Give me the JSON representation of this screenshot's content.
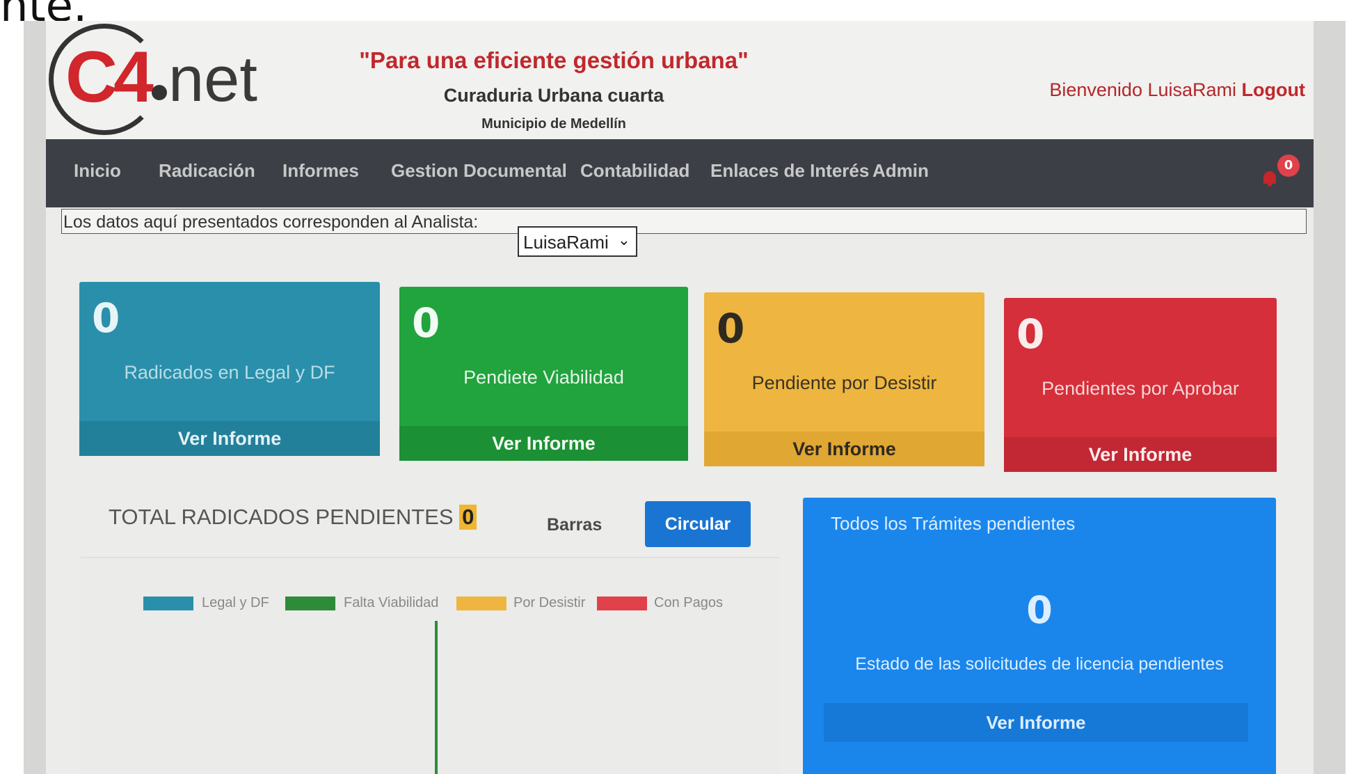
{
  "top_fragment": "nte.",
  "header": {
    "logo_text": "C4",
    "logo_suffix": "net",
    "slogan": "\"Para una eficiente gestión urbana\"",
    "org_name": "Curaduria Urbana cuarta",
    "municipality": "Municipio de Medellín",
    "welcome_prefix": "Bienvenido LuisaRami",
    "logout_label": "Logout"
  },
  "nav": {
    "items": [
      "Inicio",
      "Radicación",
      "Informes",
      "Gestion Documental",
      "Contabilidad",
      "Enlaces de Interés",
      "Admin"
    ],
    "notification_count": "0",
    "bell_icon": "bell-icon"
  },
  "analyst": {
    "label": "Los datos aquí presentados corresponden al Analista:",
    "selected": "LuisaRami"
  },
  "cards": [
    {
      "count": "0",
      "label": "Radicados en Legal y DF",
      "action": "Ver Informe",
      "color": "#2a8faa"
    },
    {
      "count": "0",
      "label": "Pendiete Viabilidad",
      "action": "Ver Informe",
      "color": "#21a33d"
    },
    {
      "count": "0",
      "label": "Pendiente por Desistir",
      "action": "Ver Informe",
      "color": "#eeb640"
    },
    {
      "count": "0",
      "label": "Pendientes por Aprobar",
      "action": "Ver Informe",
      "color": "#d42f3a"
    }
  ],
  "total": {
    "title": "TOTAL RADICADOS PENDIENTES",
    "value": "0",
    "bars_label": "Barras",
    "circular_label": "Circular"
  },
  "chart_data": {
    "type": "bar",
    "series": [
      {
        "name": "Legal y DF",
        "color": "#2a8faa"
      },
      {
        "name": "Falta Viabilidad",
        "color": "#2d8b3a"
      },
      {
        "name": "Por Desistir",
        "color": "#eeb640"
      },
      {
        "name": "Con Pagos",
        "color": "#e0414a"
      }
    ]
  },
  "todos": {
    "title": "Todos los Trámites pendientes",
    "count": "0",
    "description": "Estado de las solicitudes de licencia pendientes",
    "action": "Ver Informe",
    "color": "#1a86ec"
  }
}
